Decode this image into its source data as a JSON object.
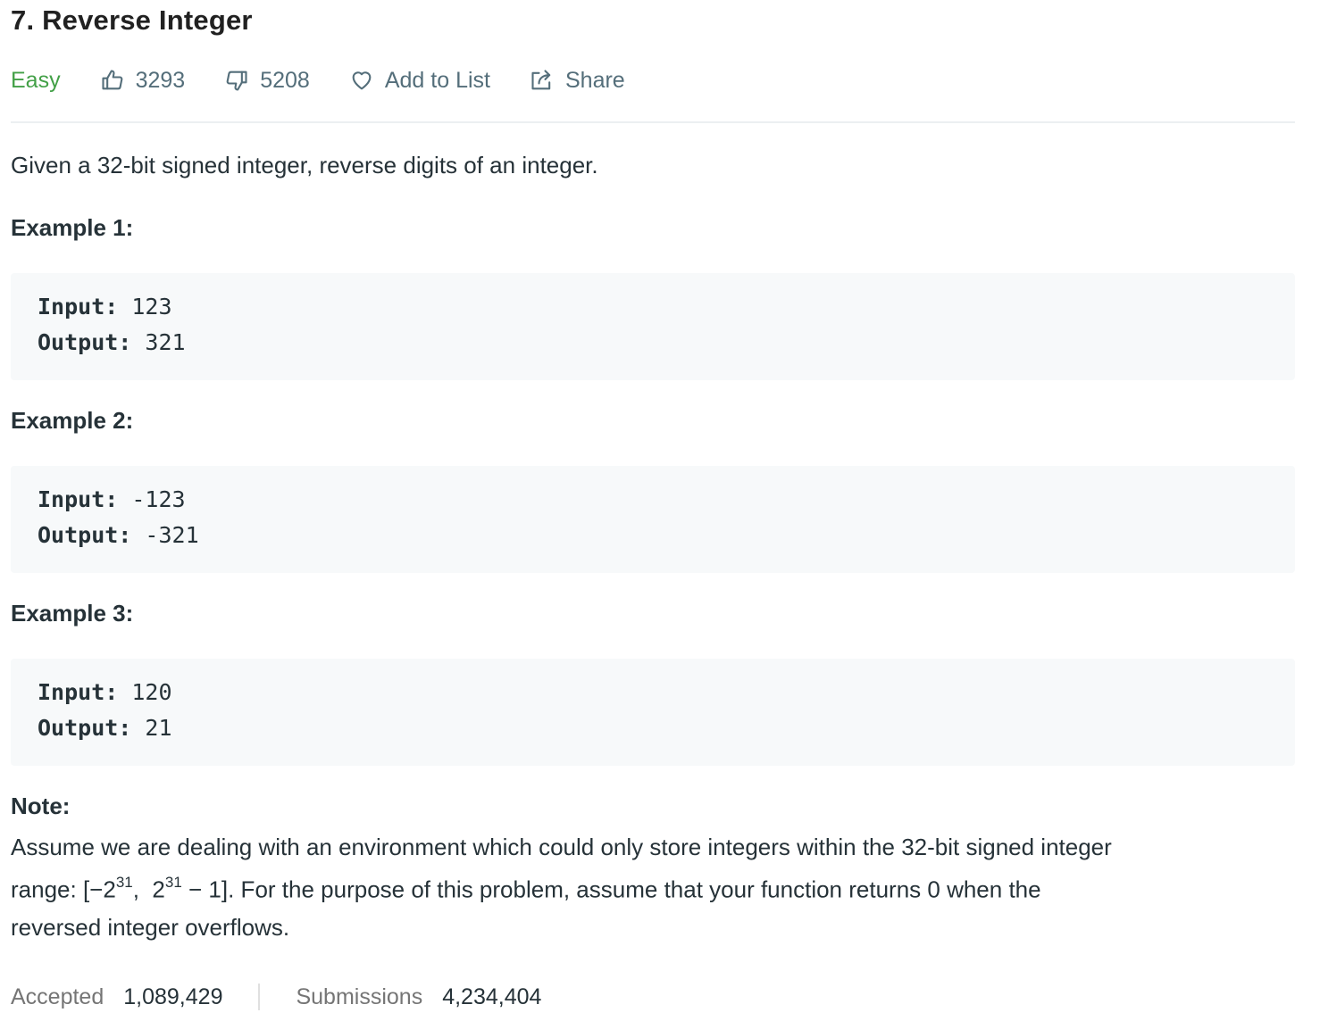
{
  "problem": {
    "title": "7. Reverse Integer",
    "difficulty": "Easy",
    "likes": "3293",
    "dislikes": "5208",
    "add_to_list": "Add to List",
    "share": "Share",
    "description": "Given a 32-bit signed integer, reverse digits of an integer."
  },
  "examples": [
    {
      "title": "Example 1:",
      "input_label": "Input:",
      "input": "123",
      "output_label": "Output:",
      "output": "321"
    },
    {
      "title": "Example 2:",
      "input_label": "Input:",
      "input": "-123",
      "output_label": "Output:",
      "output": "-321"
    },
    {
      "title": "Example 3:",
      "input_label": "Input:",
      "input": "120",
      "output_label": "Output:",
      "output": "21"
    }
  ],
  "note": {
    "title": "Note:",
    "line1": "Assume we are dealing with an environment which could only store integers within the 32-bit signed integer",
    "range_prefix": "range: [−2",
    "exp1": "31",
    "range_mid": ",  2",
    "exp2": "31",
    "range_suffix": " − 1]. For the purpose of this problem, assume that your function returns 0 when the",
    "line3": "reversed integer overflows."
  },
  "stats": {
    "accepted_label": "Accepted",
    "accepted_value": "1,089,429",
    "submissions_label": "Submissions",
    "submissions_value": "4,234,404"
  },
  "colors": {
    "difficulty_easy": "#43a047",
    "meta_text": "#546e7a",
    "code_bg": "#f7f9fa"
  },
  "icons": [
    "thumbs-up-icon",
    "thumbs-down-icon",
    "heart-icon",
    "share-icon"
  ]
}
